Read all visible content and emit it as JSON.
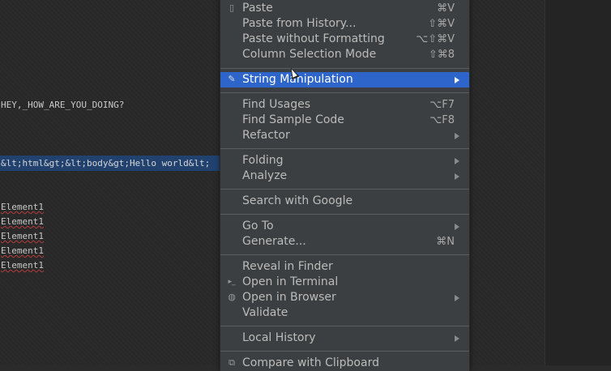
{
  "editor": {
    "lines": [
      {
        "text": "HEY,_HOW_ARE_YOU_DOING?"
      },
      {
        "text": "&lt;html&gt;&lt;body&gt;Hello world&lt;"
      },
      {
        "text": "Element1"
      },
      {
        "text": "Element1"
      },
      {
        "text": "Element1"
      },
      {
        "text": "Element1"
      },
      {
        "text": "Element1"
      }
    ]
  },
  "menu": {
    "items": [
      {
        "id": "paste",
        "label": "Paste",
        "shortcut": "⌘V",
        "icon": "clipboard-icon"
      },
      {
        "id": "paste-history",
        "label": "Paste from History...",
        "shortcut": "⇧⌘V"
      },
      {
        "id": "paste-noformat",
        "label": "Paste without Formatting",
        "shortcut": "⌥⇧⌘V"
      },
      {
        "id": "column-selection",
        "label": "Column Selection Mode",
        "shortcut": "⇧⌘8"
      },
      {
        "id": "string-manipulation",
        "label": "String Manipulation",
        "submenu": true,
        "highlighted": true,
        "icon": "pencil-icon"
      },
      {
        "id": "find-usages",
        "label": "Find Usages",
        "shortcut": "⌥F7"
      },
      {
        "id": "find-sample",
        "label": "Find Sample Code",
        "shortcut": "⌥F8"
      },
      {
        "id": "refactor",
        "label": "Refactor",
        "submenu": true
      },
      {
        "id": "folding",
        "label": "Folding",
        "submenu": true
      },
      {
        "id": "analyze",
        "label": "Analyze",
        "submenu": true
      },
      {
        "id": "search-google",
        "label": "Search with Google"
      },
      {
        "id": "go-to",
        "label": "Go To",
        "submenu": true
      },
      {
        "id": "generate",
        "label": "Generate...",
        "shortcut": "⌘N"
      },
      {
        "id": "reveal-finder",
        "label": "Reveal in Finder"
      },
      {
        "id": "open-terminal",
        "label": "Open in Terminal",
        "icon": "terminal-icon"
      },
      {
        "id": "open-browser",
        "label": "Open in Browser",
        "submenu": true,
        "icon": "globe-icon"
      },
      {
        "id": "validate",
        "label": "Validate"
      },
      {
        "id": "local-history",
        "label": "Local History",
        "submenu": true
      },
      {
        "id": "compare-clipboard",
        "label": "Compare with Clipboard",
        "icon": "compare-icon"
      }
    ]
  },
  "colors": {
    "highlight": "#2e65ca",
    "menu_bg": "#3c3f41",
    "editor_bg": "#2b2b2b",
    "selection": "#21426f"
  }
}
